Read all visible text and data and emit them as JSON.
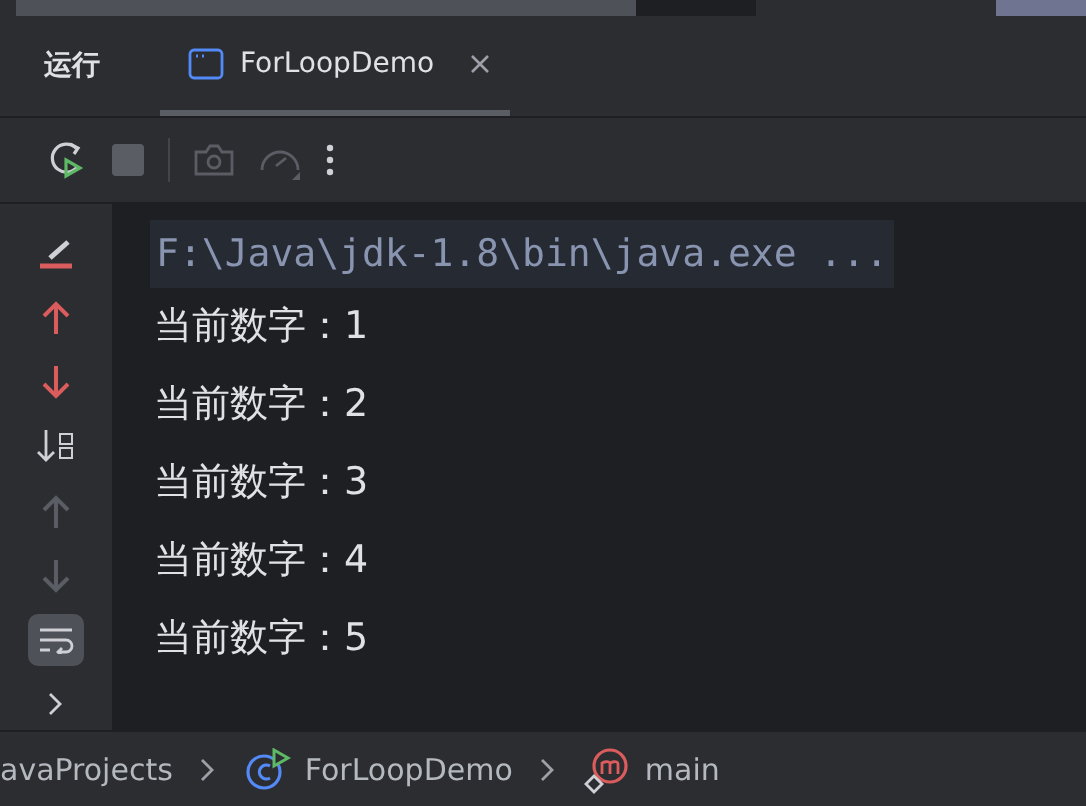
{
  "panel": {
    "title": "运行",
    "tabs": [
      {
        "label": "ForLoopDemo",
        "selected": true
      }
    ]
  },
  "toolbar": [
    {
      "kind": "rerun",
      "disabled": false
    },
    {
      "kind": "stop",
      "disabled": true
    },
    {
      "kind": "sep"
    },
    {
      "kind": "camera",
      "disabled": true
    },
    {
      "kind": "gauge",
      "disabled": true
    },
    {
      "kind": "more",
      "disabled": false
    }
  ],
  "gutter": [
    {
      "kind": "clear",
      "selected": false
    },
    {
      "kind": "up-red",
      "selected": false
    },
    {
      "kind": "down-red",
      "selected": false
    },
    {
      "kind": "sort",
      "disabled": false,
      "selected": false
    },
    {
      "kind": "up",
      "disabled": true,
      "selected": false
    },
    {
      "kind": "down",
      "disabled": true,
      "selected": false
    },
    {
      "kind": "wrap",
      "disabled": false,
      "selected": true
    },
    {
      "kind": "chevron",
      "disabled": false,
      "selected": false
    }
  ],
  "console": {
    "command": "F:\\Java\\jdk-1.8\\bin\\java.exe ...",
    "lines": [
      "当前数字：1",
      "当前数字：2",
      "当前数字：3",
      "当前数字：4",
      "当前数字：5"
    ]
  },
  "breadcrumbs": [
    {
      "kind": "text",
      "label": "avaProjects"
    },
    {
      "kind": "class",
      "label": "ForLoopDemo"
    },
    {
      "kind": "method",
      "label": "main"
    }
  ]
}
